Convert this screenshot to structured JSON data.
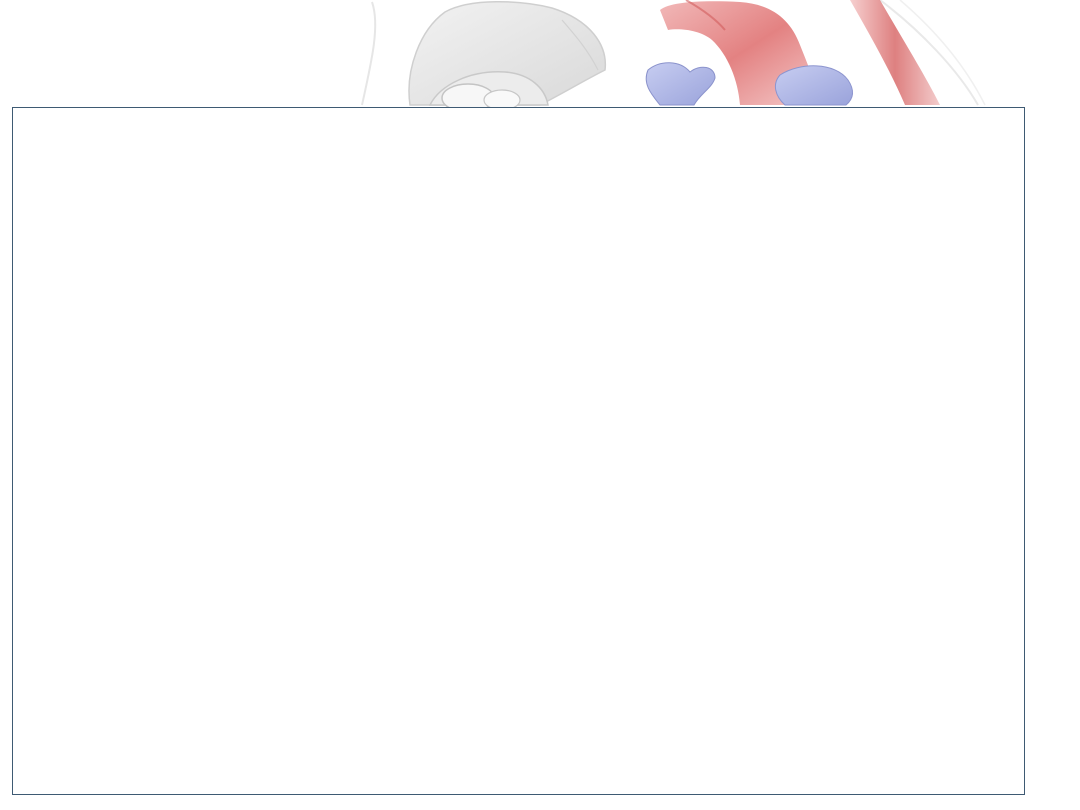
{
  "slide": {
    "background_image": "heart-anatomy-watermark",
    "content_box": {
      "text": "",
      "border_color": "#3e5a73"
    }
  },
  "colors": {
    "background": "#ffffff",
    "artery_red": "#e46a6a",
    "vein_blue": "#9aa4dc",
    "tissue_gray": "#d8d8d8"
  }
}
